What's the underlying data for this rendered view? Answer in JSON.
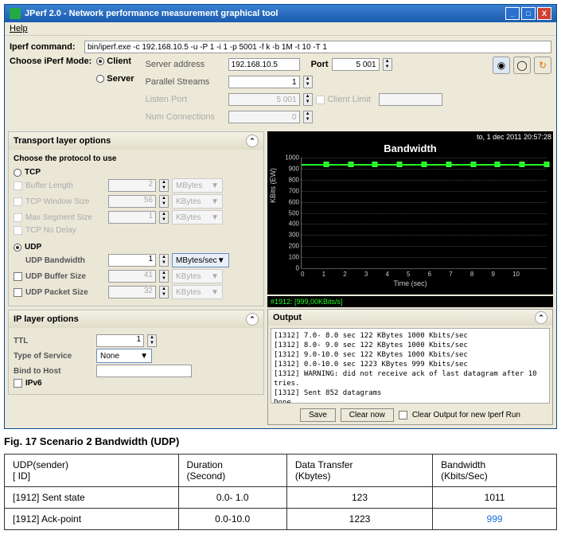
{
  "window": {
    "title": "JPerf 2.0 - Network performance measurement graphical tool",
    "menu_help": "Help"
  },
  "toolbar": {
    "cmd_label": "Iperf command:",
    "cmd_value": "bin/iperf.exe -c 192.168.10.5 -u -P 1 -i 1 -p 5001 -f k -b 1M -t 10 -T 1",
    "mode_label": "Choose iPerf Mode:",
    "client": "Client",
    "server": "Server",
    "server_addr_label": "Server address",
    "server_addr_value": "192.168.10.5",
    "port_label": "Port",
    "port_value": "5 001",
    "parallel_label": "Parallel Streams",
    "parallel_value": "1",
    "listen_port_label": "Listen Port",
    "listen_port_value": "5 001",
    "client_limit_label": "Client Limit",
    "num_conn_label": "Num Connections",
    "num_conn_value": "0"
  },
  "transport": {
    "title": "Transport layer options",
    "choose": "Choose the protocol to use",
    "tcp": "TCP",
    "buf_len": "Buffer Length",
    "buf_len_v": "2",
    "buf_len_u": "MBytes",
    "win_size": "TCP Window Size",
    "win_size_v": "56",
    "win_size_u": "KBytes",
    "mss": "Max Segment Size",
    "mss_v": "1",
    "mss_u": "KBytes",
    "nodelay": "TCP No Delay",
    "udp": "UDP",
    "udp_bw": "UDP Bandwidth",
    "udp_bw_v": "1",
    "udp_bw_u": "MBytes/sec",
    "udp_buf": "UDP Buffer Size",
    "udp_buf_v": "41",
    "udp_buf_u": "KBytes",
    "udp_pkt": "UDP Packet Size",
    "udp_pkt_v": "32",
    "udp_pkt_u": "KBytes"
  },
  "ip": {
    "title": "IP layer options",
    "ttl": "TTL",
    "ttl_v": "1",
    "tos": "Type of Service",
    "tos_v": "None",
    "bind": "Bind to Host",
    "ipv6": "IPv6"
  },
  "chart": {
    "date": "to, 1 dec 2011 20:57:28",
    "title": "Bandwidth",
    "ylabel": "KBits (EW)",
    "xlabel": "Time (sec)",
    "legend": "#1912: [999,00KBits/s]"
  },
  "chart_data": {
    "type": "line",
    "title": "Bandwidth",
    "xlabel": "Time (sec)",
    "ylabel": "KBits (EW)",
    "ylim": [
      0,
      1000
    ],
    "xlim": [
      0,
      10
    ],
    "yticks": [
      0,
      100,
      200,
      300,
      400,
      500,
      600,
      700,
      800,
      900,
      1000
    ],
    "xticks": [
      0,
      1,
      2,
      3,
      4,
      5,
      6,
      7,
      8,
      9,
      10
    ],
    "series": [
      {
        "name": "#1912",
        "x": [
          1,
          2,
          3,
          4,
          5,
          6,
          7,
          8,
          9,
          10
        ],
        "y": [
          999,
          999,
          999,
          999,
          999,
          999,
          999,
          999,
          999,
          999
        ]
      }
    ]
  },
  "output": {
    "title": "Output",
    "lines": [
      "[1312]  7.0- 8.0 sec   122 KBytes  1000 Kbits/sec",
      "[1312]  8.0- 9.0 sec   122 KBytes  1000 Kbits/sec",
      "[1312]  9.0-10.0 sec   122 KBytes  1000 Kbits/sec",
      "[1312]  0.0-10.0 sec  1223 KBytes   999 Kbits/sec",
      "[1312] WARNING: did not receive ack of last datagram after 10 tries.",
      "[1312] Sent 852 datagrams",
      "Done."
    ],
    "save": "Save",
    "clear": "Clear now",
    "clear_chk": "Clear Output for new Iperf Run"
  },
  "doc": {
    "caption": "Fig. 17 Scenario 2 Bandwidth (UDP)",
    "h1a": "UDP(sender)",
    "h1b": "[ ID]",
    "h2a": "Duration",
    "h2b": "(Second)",
    "h3a": "Data Transfer",
    "h3b": "(Kbytes)",
    "h4a": "Bandwidth",
    "h4b": "(Kbits/Sec)",
    "r1c1": "[1912] Sent state",
    "r1c2": "0.0- 1.0",
    "r1c3": "123",
    "r1c4": "1011",
    "r2c1": "[1912] Ack-point",
    "r2c2": "0.0-10.0",
    "r2c3": "1223",
    "r2c4": "999"
  }
}
